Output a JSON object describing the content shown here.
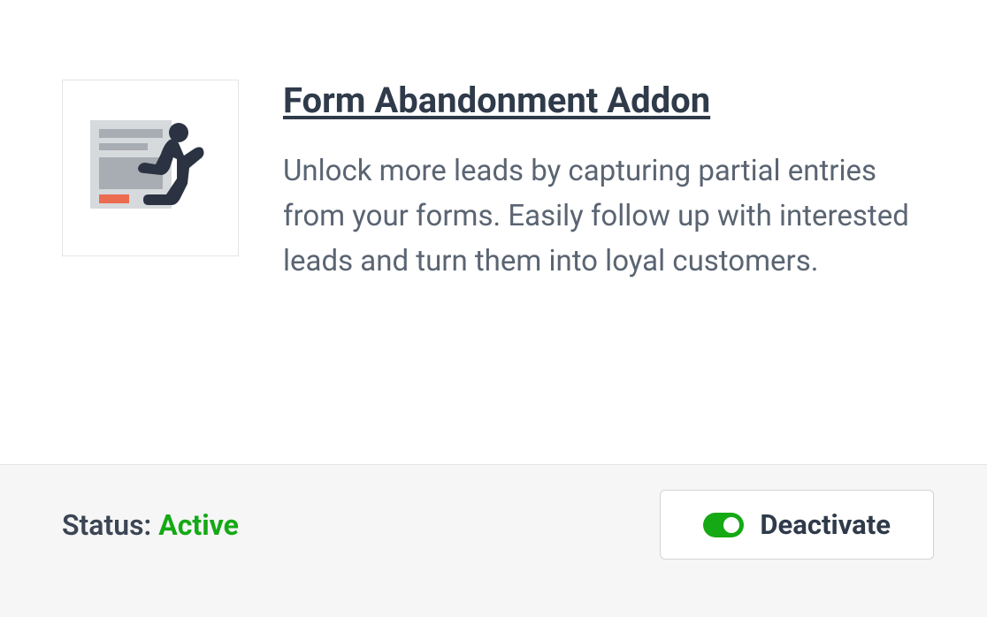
{
  "addon": {
    "title": "Form Abandonment Addon",
    "description": "Unlock more leads by capturing partial entries from your forms. Easily follow up with interested leads and turn them into loyal customers."
  },
  "footer": {
    "status_label": "Status: ",
    "status_value": "Active",
    "deactivate_label": "Deactivate"
  },
  "colors": {
    "active_green": "#15a915",
    "accent_orange": "#ec6c4f",
    "icon_dark": "#2b3342",
    "icon_mid_grey": "#a8adb3",
    "icon_light_grey": "#d7dadd"
  }
}
